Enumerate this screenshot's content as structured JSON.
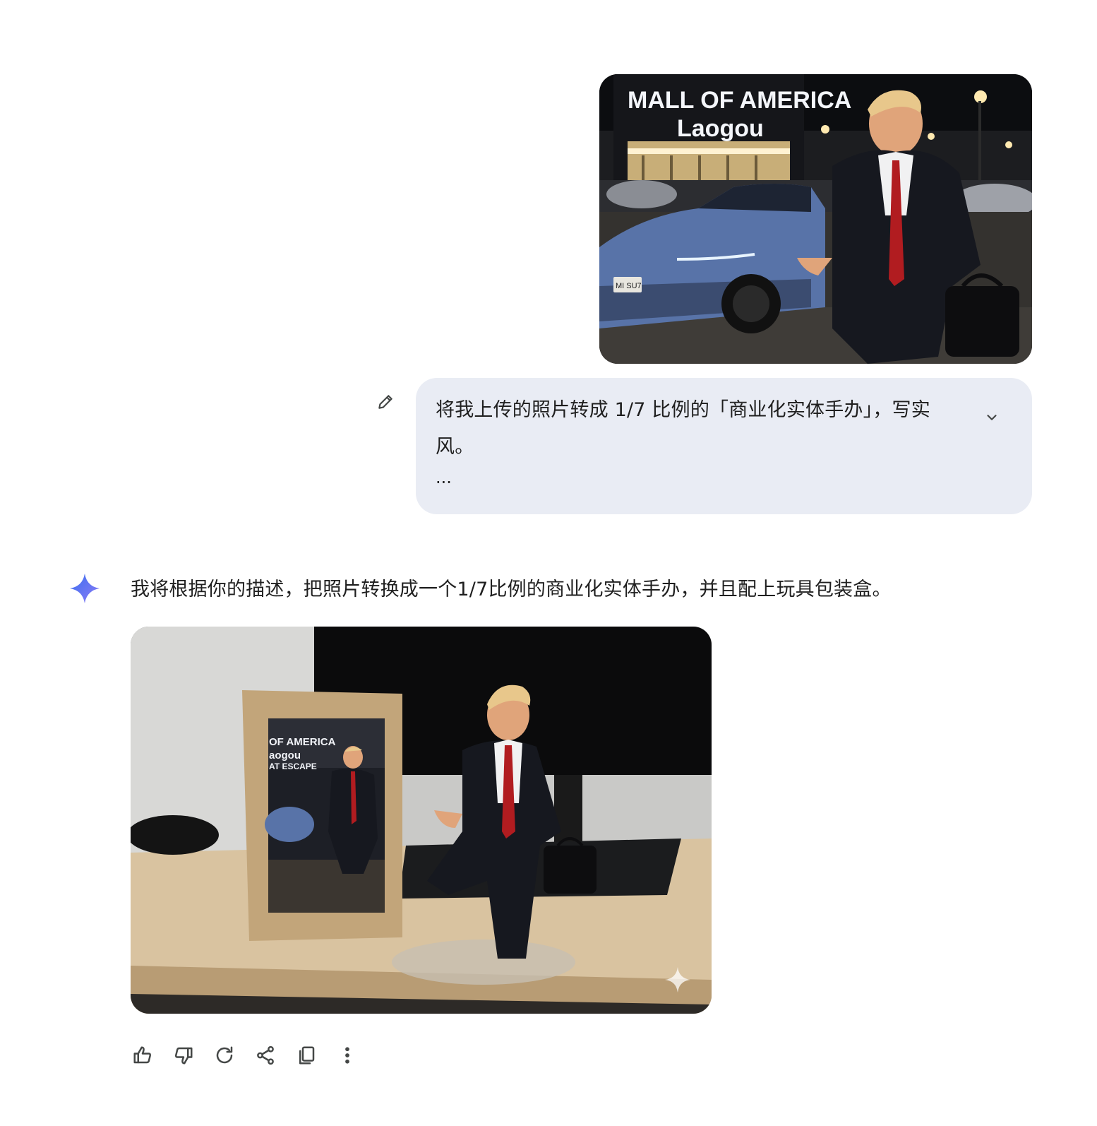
{
  "user_message": {
    "image_sign_line1": "MALL OF AMERICA",
    "image_sign_line2": "Laogou",
    "image_plate": "MI SU7",
    "text": "将我上传的照片转成 1/7 比例的「商业化实体手办」，写实风。",
    "more": "...",
    "edit_icon": "pencil-icon",
    "expand_icon": "chevron-down-icon"
  },
  "assistant": {
    "avatar_icon": "sparkle-icon",
    "text": "我将根据你的描述，把照片转换成一个1/7比例的商业化实体手办，并且配上玩具包装盒。",
    "box_sign_line1": "OF AMERICA",
    "box_sign_line2": "aogou",
    "box_sign_line3": "AT ESCAPE",
    "watermark_icon": "sparkle-watermark-icon"
  },
  "toolbar": [
    {
      "name": "thumbs-up-icon"
    },
    {
      "name": "thumbs-down-icon"
    },
    {
      "name": "regenerate-icon"
    },
    {
      "name": "share-icon"
    },
    {
      "name": "copy-icon"
    },
    {
      "name": "more-options-icon"
    }
  ],
  "colors": {
    "bubble_bg": "#e9ecf4",
    "spark_blue": "#4d7cf2",
    "icon_gray": "#444746"
  }
}
